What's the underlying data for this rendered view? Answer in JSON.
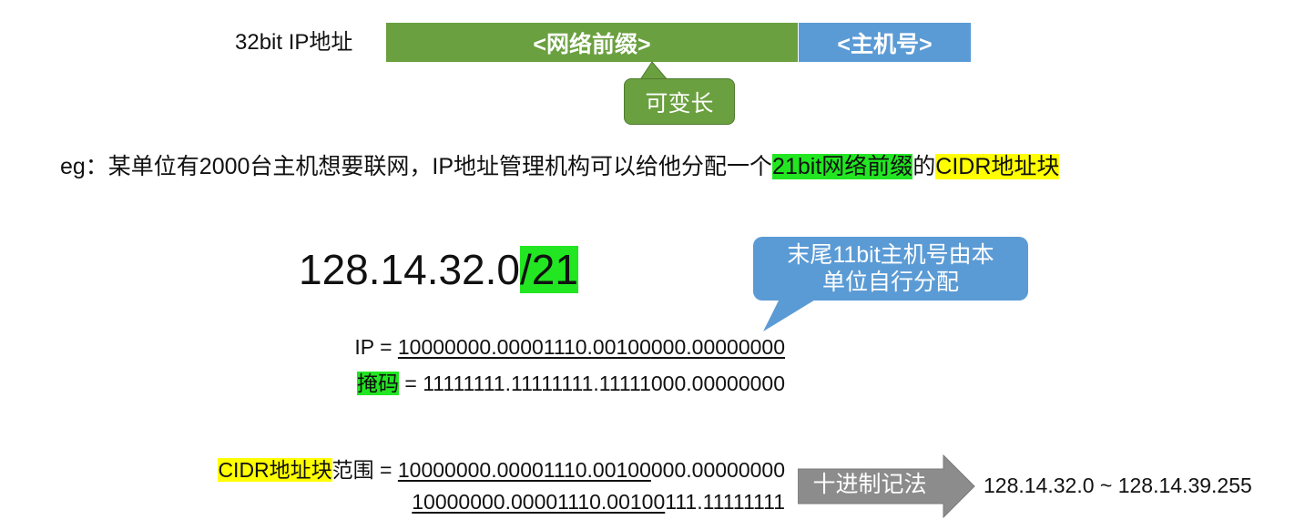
{
  "ip_bar": {
    "label": "32bit IP地址",
    "network_prefix": "<网络前缀>",
    "host": "<主机号>",
    "variable_note": "可变长"
  },
  "example": {
    "prefix_text": "eg：某单位有2000台主机想要联网，IP地址管理机构可以给他分配一个",
    "highlight_green": "21bit网络前缀",
    "middle_text": "的",
    "highlight_yellow": "CIDR地址块"
  },
  "cidr": {
    "address": "128.14.32.0",
    "suffix": "/21"
  },
  "callout": {
    "line1": "末尾11bit主机号由本",
    "line2": "单位自行分配"
  },
  "ip_row": {
    "label": "IP =",
    "network_part": "10000000.00001110.00100",
    "host_part": "000.00000000"
  },
  "mask_row": {
    "label": "掩码",
    "equals": " =",
    "value": "11111111.11111111.11111000.00000000"
  },
  "range": {
    "label_highlight": "CIDR地址块",
    "label_rest": "范围 =",
    "row1_network": "10000000.00001110.00100",
    "row1_host": "000.00000000",
    "row2_network": "10000000.00001110.00100",
    "row2_host": "111.11111111",
    "arrow_label": "十进制记法",
    "decimal": "128.14.32.0 ~ 128.14.39.255"
  },
  "colors": {
    "green_bar": "#6aa03f",
    "blue_bar": "#5b9bd5",
    "highlight_green": "#22e622",
    "highlight_yellow": "#ffff00",
    "arrow_gray": "#8c8c8c"
  }
}
